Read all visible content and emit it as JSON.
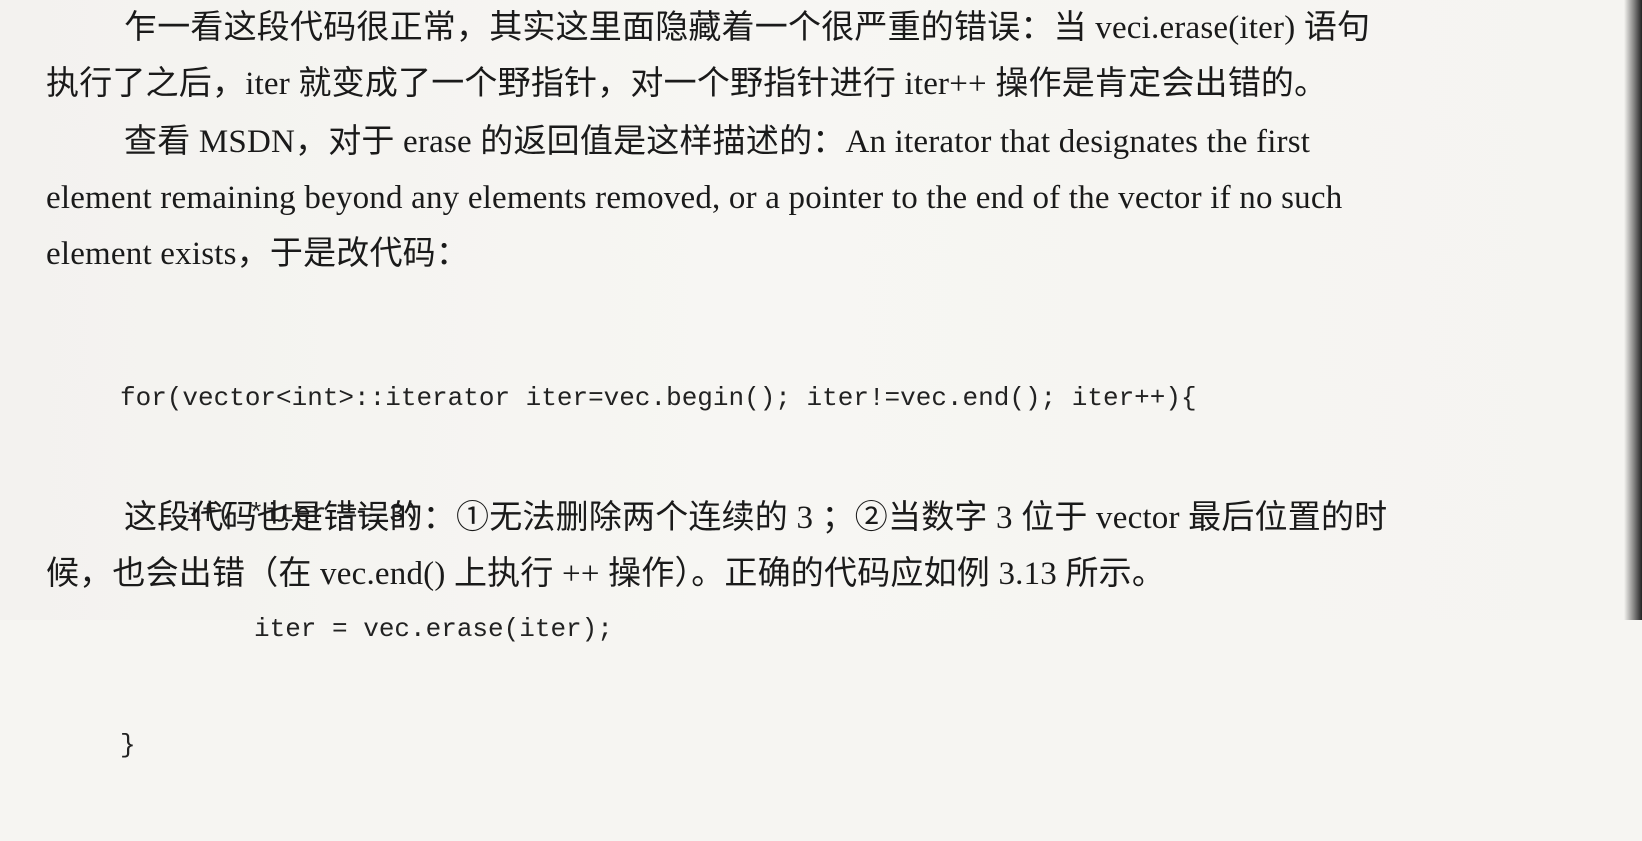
{
  "paragraph1": {
    "line1": "乍一看这段代码很正常，其实这里面隐藏着一个很严重的错误：当 veci.erase(iter) 语句",
    "line2": "执行了之后，iter 就变成了一个野指针，对一个野指针进行 iter++ 操作是肯定会出错的。"
  },
  "paragraph2": {
    "line1": "查看 MSDN，对于 erase 的返回值是这样描述的：An iterator that designates the first",
    "line2": "element remaining beyond any elements removed, or a pointer to the end of the vector if no such",
    "line3": "element exists，于是改代码："
  },
  "code": {
    "line1": "for(vector<int>::iterator iter=vec.begin(); iter!=vec.end(); iter++){",
    "line2": "if( *iter == 3)",
    "line3": "iter = vec.erase(iter);",
    "line4": "}"
  },
  "paragraph3": {
    "line1": "这段代码也是错误的：①无法删除两个连续的 3 ；②当数字 3 位于 vector 最后位置的时",
    "line2": "候，也会出错（在 vec.end() 上执行 ++ 操作）。正确的代码应如例 3.13 所示。"
  }
}
